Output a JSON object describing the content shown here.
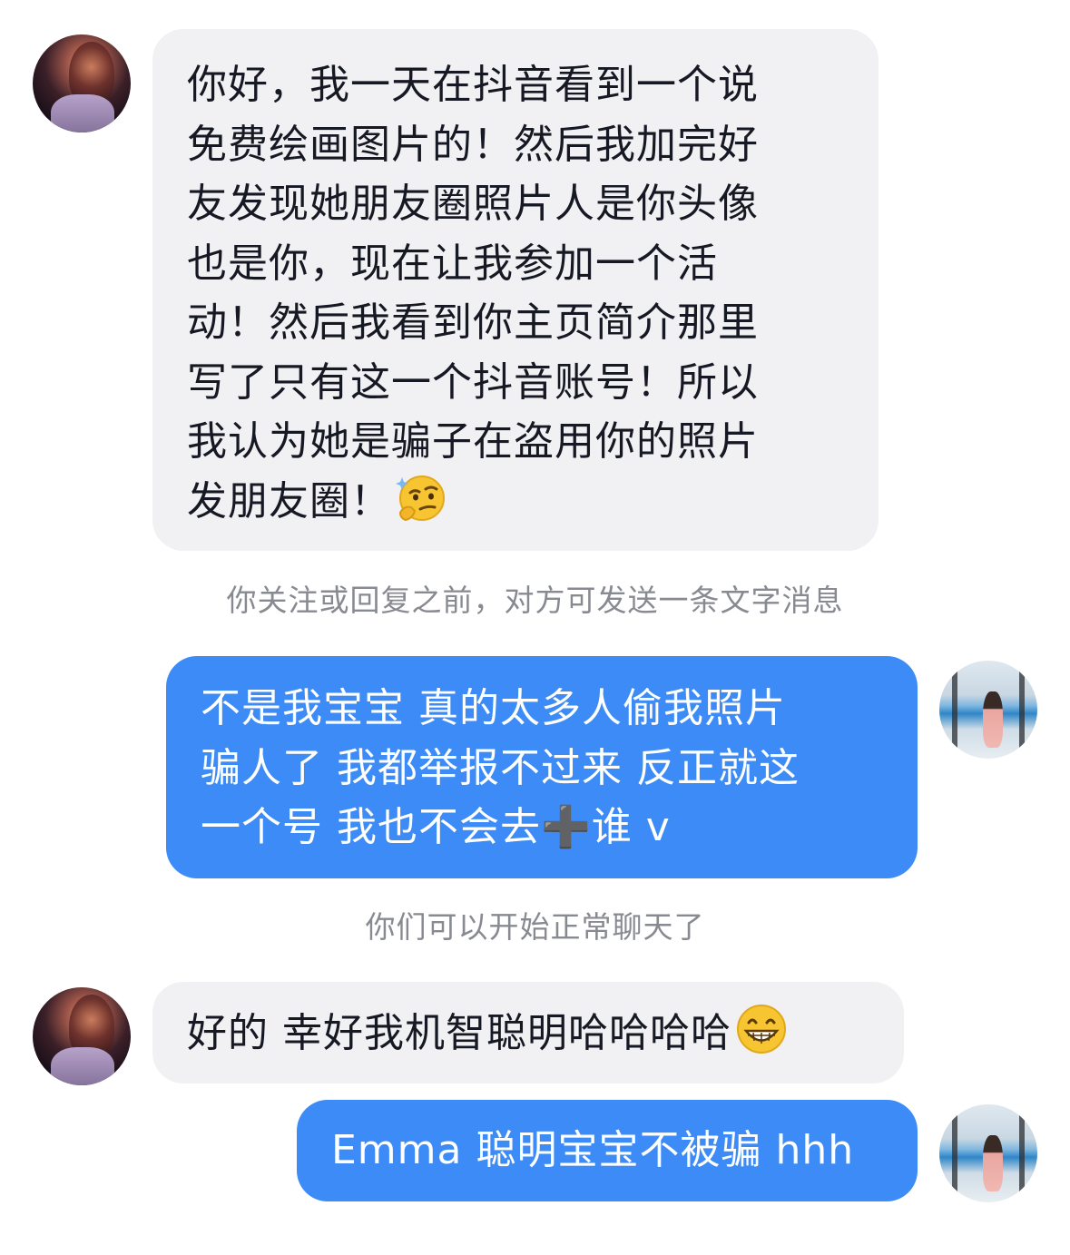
{
  "messages": [
    {
      "from": "them",
      "lines": [
        "你好，我一天在抖音看到一个说",
        "免费绘画图片的！然后我加完好",
        "友发现她朋友圈照片人是你头像",
        "也是你，现在让我参加一个活",
        "动！然后我看到你主页简介那里",
        "写了只有这一个抖音账号！所以",
        "我认为她是骗子在盗用你的照片",
        "发朋友圈！"
      ],
      "trailing_emoji": "thinking-face-emoji"
    },
    {
      "from": "me",
      "lines": [
        "不是我宝宝 真的太多人偷我照片",
        "骗人了 我都举报不过来 反正就这",
        "一个号 我也不会去➕谁 v"
      ]
    },
    {
      "from": "them",
      "lines": [
        "好的 幸好我机智聪明哈哈哈哈"
      ],
      "trailing_emoji": "grinning-face-emoji"
    },
    {
      "from": "me",
      "lines": [
        "Emma 聪明宝宝不被骗 hhh"
      ]
    }
  ],
  "notices": {
    "before_reply": "你关注或回复之前，对方可发送一条文字消息",
    "can_chat": "你们可以开始正常聊天了"
  },
  "colors": {
    "incoming_bubble": "#f1f1f3",
    "outgoing_bubble": "#3c8bf6",
    "notice_text": "#888a91"
  }
}
